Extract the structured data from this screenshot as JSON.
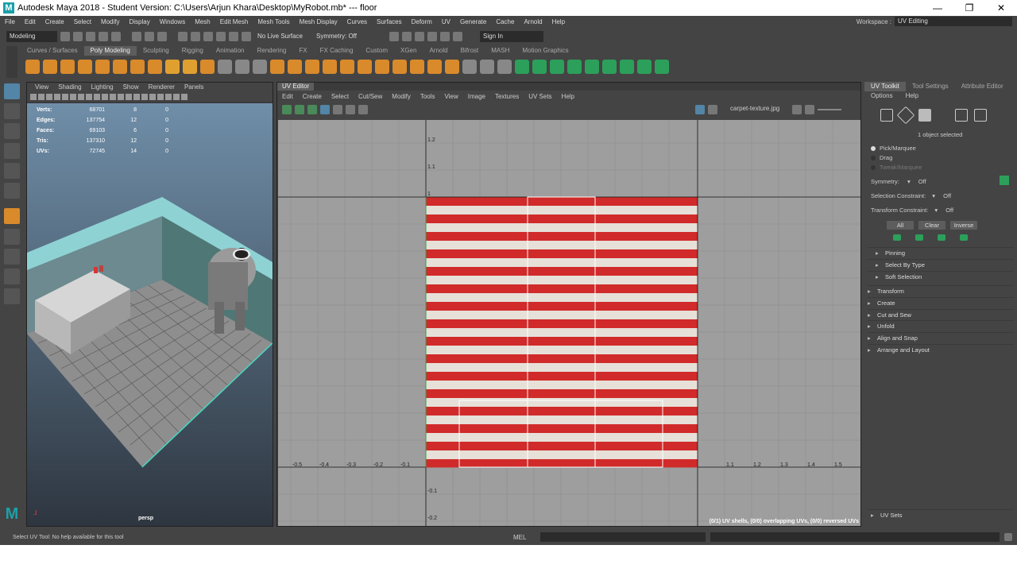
{
  "window": {
    "title": "Autodesk Maya 2018 - Student Version: C:\\Users\\Arjun Khara\\Desktop\\MyRobot.mb*   ---   floor",
    "minimize": "—",
    "maximize": "❐",
    "close": "✕"
  },
  "menubar": [
    "File",
    "Edit",
    "Create",
    "Select",
    "Modify",
    "Display",
    "Windows",
    "Mesh",
    "Edit Mesh",
    "Mesh Tools",
    "Mesh Display",
    "Curves",
    "Surfaces",
    "Deform",
    "UV",
    "Generate",
    "Cache",
    "Arnold",
    "Help"
  ],
  "workspace": {
    "label": "Workspace :",
    "value": "UV Editing"
  },
  "statusline": {
    "mode": "Modeling",
    "live_surface": "No Live Surface",
    "symmetry": "Symmetry: Off",
    "sign_in": "Sign In"
  },
  "shelf_tabs": [
    "Curves / Surfaces",
    "Poly Modeling",
    "Sculpting",
    "Rigging",
    "Animation",
    "Rendering",
    "FX",
    "FX Caching",
    "Custom",
    "XGen",
    "Arnold",
    "Bifrost",
    "MASH",
    "Motion Graphics"
  ],
  "viewport": {
    "menu": [
      "View",
      "Shading",
      "Lighting",
      "Show",
      "Renderer",
      "Panels"
    ],
    "hud": [
      {
        "k": "Verts:",
        "v": "68701",
        "s": "8",
        "u": "0"
      },
      {
        "k": "Edges:",
        "v": "137754",
        "s": "12",
        "u": "0"
      },
      {
        "k": "Faces:",
        "v": "69103",
        "s": "6",
        "u": "0"
      },
      {
        "k": "Tris:",
        "v": "137310",
        "s": "12",
        "u": "0"
      },
      {
        "k": "UVs:",
        "v": "72745",
        "s": "14",
        "u": "0"
      }
    ],
    "camera": "persp"
  },
  "uv_editor": {
    "tab": "UV Editor",
    "menu": [
      "Edit",
      "Create",
      "Select",
      "Cut/Sew",
      "Modify",
      "Tools",
      "View",
      "Image",
      "Textures",
      "UV Sets",
      "Help"
    ],
    "texture": "carpet-texture.jpg",
    "x_ticks": [
      "-0.5",
      "-0.4",
      "-0.3",
      "-0.2",
      "-0.1",
      "1.1",
      "1.2",
      "1.3",
      "1.4",
      "1.5"
    ],
    "y_ticks": [
      "1.2",
      "1.1",
      "1",
      "-0.1",
      "-0.2"
    ],
    "status": "(0/1) UV shells, (0/0) overlapping UVs, (0/0) reversed UVs"
  },
  "uv_toolkit": {
    "tabs": [
      "UV Toolkit",
      "Tool Settings",
      "Attribute Editor"
    ],
    "menu": [
      "Options",
      "Help"
    ],
    "selected": "1 object selected",
    "modes": [
      "Pick/Marquee",
      "Drag",
      "Tweak/Marquee"
    ],
    "symmetry_label": "Symmetry:",
    "symmetry_value": "Off",
    "sel_constraint_label": "Selection Constraint:",
    "sel_constraint_value": "Off",
    "xf_constraint_label": "Transform Constraint:",
    "xf_constraint_value": "Off",
    "buttons": [
      "All",
      "Clear",
      "Inverse"
    ],
    "sections": [
      "Pinning",
      "Select By Type",
      "Soft Selection",
      "Transform",
      "Create",
      "Cut and Sew",
      "Unfold",
      "Align and Snap",
      "Arrange and Layout"
    ],
    "uv_sets": "UV Sets"
  },
  "helpline": {
    "text": "Select UV Tool: No help available for this tool",
    "mel": "MEL"
  },
  "colors": {
    "accent": "#5285a6",
    "stripe_red": "#d12a2a",
    "stripe_white": "#e6e0d8"
  }
}
